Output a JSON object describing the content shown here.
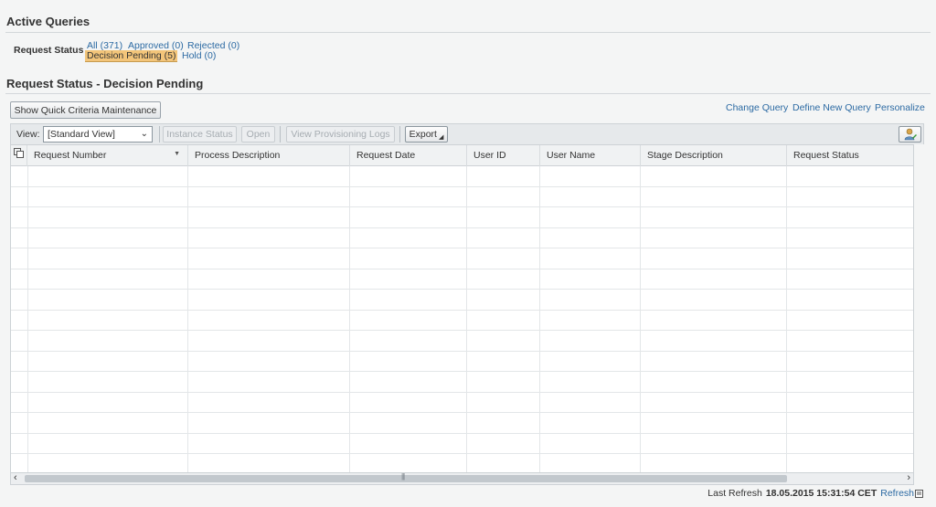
{
  "page": {
    "title": "Active Queries",
    "section_title": "Request Status - Decision Pending"
  },
  "filter": {
    "label": "Request Status",
    "links": [
      {
        "label": "All (371)"
      },
      {
        "label": "Approved (0)"
      },
      {
        "label": "Rejected (0)"
      },
      {
        "label": "Decision Pending (5)",
        "active": true
      },
      {
        "label": "Hold (0)"
      }
    ]
  },
  "quick_criteria_button": "Show Quick Criteria Maintenance",
  "query_links": {
    "change": "Change Query",
    "define": "Define New Query",
    "personalize": "Personalize"
  },
  "toolbar": {
    "view_label": "View:",
    "view_value": "[Standard View]",
    "instance_status": "Instance Status",
    "open": "Open",
    "view_logs": "View Provisioning Logs",
    "export": "Export"
  },
  "table": {
    "columns": [
      "Request Number",
      "Process Description",
      "Request Date",
      "User ID",
      "User Name",
      "Stage Description",
      "Request Status"
    ],
    "rows": []
  },
  "status_bar": {
    "last_refresh_label": "Last Refresh",
    "timestamp": "18.05.2015 15:31:54 CET",
    "refresh": "Refresh"
  },
  "colors": {
    "link": "#2c6aa3",
    "active_filter": "#f3c57a",
    "background": "#f4f5f5"
  }
}
